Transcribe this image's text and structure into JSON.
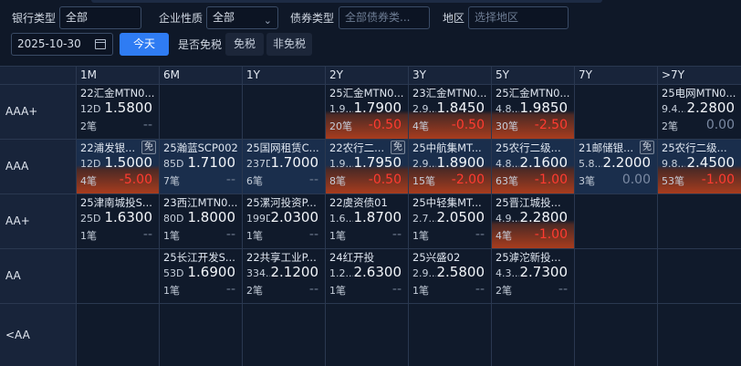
{
  "filters": {
    "bank_type_label": "银行类型",
    "bank_type_value": "全部",
    "company_type_label": "企业性质",
    "company_type_value": "全部",
    "bond_type_label": "债券类型",
    "bond_type_placeholder": "全部债券类...",
    "region_label": "地区",
    "region_placeholder": "选择地区",
    "date_value": "2025-10-30",
    "today_label": "今天",
    "tax_label": "是否免税",
    "tax_free_label": "免税",
    "non_tax_free_label": "非免税"
  },
  "columns": [
    "1M",
    "6M",
    "1Y",
    "2Y",
    "3Y",
    "5Y",
    "7Y",
    ">7Y"
  ],
  "rows": [
    "AAA+",
    "AAA",
    "AA+",
    "AA",
    "<AA"
  ],
  "cells": [
    {
      "row": 0,
      "col": 0,
      "name": "22汇金MTN0...",
      "term": "12D",
      "yield": "1.5800",
      "count": "2笔",
      "change": "--",
      "tone": "dash",
      "blue": false,
      "red": false,
      "badge": ""
    },
    {
      "row": 0,
      "col": 3,
      "name": "25汇金MTN0...",
      "term": "1.9...",
      "yield": "1.7900",
      "count": "20笔",
      "change": "-0.50",
      "tone": "neg",
      "blue": false,
      "red": true,
      "badge": ""
    },
    {
      "row": 0,
      "col": 4,
      "name": "23汇金MTN0...",
      "term": "2.9...",
      "yield": "1.8450",
      "count": "4笔",
      "change": "-0.50",
      "tone": "neg",
      "blue": false,
      "red": true,
      "badge": ""
    },
    {
      "row": 0,
      "col": 5,
      "name": "25汇金MTN0...",
      "term": "4.8...",
      "yield": "1.9850",
      "count": "30笔",
      "change": "-2.50",
      "tone": "neg",
      "blue": false,
      "red": true,
      "badge": ""
    },
    {
      "row": 0,
      "col": 7,
      "name": "25电网MTN0...",
      "term": "9.4...",
      "yield": "2.2800",
      "count": "2笔",
      "change": "0.00",
      "tone": "zero",
      "blue": false,
      "red": false,
      "badge": ""
    },
    {
      "row": 1,
      "col": 0,
      "name": "22浦发银...",
      "term": "12D",
      "yield": "1.5000",
      "count": "4笔",
      "change": "-5.00",
      "tone": "neg",
      "blue": true,
      "red": true,
      "badge": "免"
    },
    {
      "row": 1,
      "col": 1,
      "name": "25瀚蓝SCP002",
      "term": "85D",
      "yield": "1.7100",
      "count": "7笔",
      "change": "--",
      "tone": "dash",
      "blue": true,
      "red": false,
      "badge": ""
    },
    {
      "row": 1,
      "col": 2,
      "name": "25国网租赁C...",
      "term": "237D",
      "yield": "1.7000",
      "count": "6笔",
      "change": "--",
      "tone": "dash",
      "blue": true,
      "red": false,
      "badge": ""
    },
    {
      "row": 1,
      "col": 3,
      "name": "22农行二...",
      "term": "1.9...",
      "yield": "1.7950",
      "count": "8笔",
      "change": "-0.50",
      "tone": "neg",
      "blue": true,
      "red": true,
      "badge": "免"
    },
    {
      "row": 1,
      "col": 4,
      "name": "25中航集MT...",
      "term": "2.9...",
      "yield": "1.8900",
      "count": "15笔",
      "change": "-2.00",
      "tone": "neg",
      "blue": true,
      "red": true,
      "badge": ""
    },
    {
      "row": 1,
      "col": 5,
      "name": "25农行二级...",
      "term": "4.8...",
      "yield": "2.1600",
      "count": "63笔",
      "change": "-1.00",
      "tone": "neg",
      "blue": true,
      "red": true,
      "badge": ""
    },
    {
      "row": 1,
      "col": 6,
      "name": "21邮储银...",
      "term": "5.8...",
      "yield": "2.2000",
      "count": "3笔",
      "change": "0.00",
      "tone": "zero",
      "blue": true,
      "red": false,
      "badge": "免"
    },
    {
      "row": 1,
      "col": 7,
      "name": "25农行二级...",
      "term": "9.8...",
      "yield": "2.4500",
      "count": "53笔",
      "change": "-1.00",
      "tone": "neg",
      "blue": true,
      "red": true,
      "badge": ""
    },
    {
      "row": 2,
      "col": 0,
      "name": "25津南城投S...",
      "term": "25D",
      "yield": "1.6300",
      "count": "1笔",
      "change": "--",
      "tone": "dash",
      "blue": false,
      "red": false,
      "badge": ""
    },
    {
      "row": 2,
      "col": 1,
      "name": "23西江MTN0...",
      "term": "80D",
      "yield": "1.8000",
      "count": "1笔",
      "change": "--",
      "tone": "dash",
      "blue": false,
      "red": false,
      "badge": ""
    },
    {
      "row": 2,
      "col": 2,
      "name": "25漯河投资P...",
      "term": "199D",
      "yield": "2.0300",
      "count": "1笔",
      "change": "--",
      "tone": "dash",
      "blue": false,
      "red": false,
      "badge": ""
    },
    {
      "row": 2,
      "col": 3,
      "name": "22虞资债01",
      "term": "1.6...",
      "yield": "1.8700",
      "count": "1笔",
      "change": "--",
      "tone": "dash",
      "blue": false,
      "red": false,
      "badge": ""
    },
    {
      "row": 2,
      "col": 4,
      "name": "25中轻集MT...",
      "term": "2.7...",
      "yield": "2.0500",
      "count": "1笔",
      "change": "--",
      "tone": "dash",
      "blue": false,
      "red": false,
      "badge": ""
    },
    {
      "row": 2,
      "col": 5,
      "name": "25晋江城投...",
      "term": "4.9...",
      "yield": "2.2800",
      "count": "4笔",
      "change": "-1.00",
      "tone": "neg",
      "blue": false,
      "red": true,
      "badge": ""
    },
    {
      "row": 3,
      "col": 1,
      "name": "25长江开发S...",
      "term": "53D",
      "yield": "1.6900",
      "count": "1笔",
      "change": "--",
      "tone": "dash",
      "blue": false,
      "red": false,
      "badge": ""
    },
    {
      "row": 3,
      "col": 2,
      "name": "22共享工业P...",
      "term": "334...",
      "yield": "2.1200",
      "count": "2笔",
      "change": "--",
      "tone": "dash",
      "blue": false,
      "red": false,
      "badge": ""
    },
    {
      "row": 3,
      "col": 3,
      "name": "24红开投",
      "term": "1.2...",
      "yield": "2.6300",
      "count": "1笔",
      "change": "--",
      "tone": "dash",
      "blue": false,
      "red": false,
      "badge": ""
    },
    {
      "row": 3,
      "col": 4,
      "name": "25兴盛02",
      "term": "2.9...",
      "yield": "2.5800",
      "count": "1笔",
      "change": "--",
      "tone": "dash",
      "blue": false,
      "red": false,
      "badge": ""
    },
    {
      "row": 3,
      "col": 5,
      "name": "25滹沱新投...",
      "term": "4.3...",
      "yield": "2.7300",
      "count": "2笔",
      "change": "--",
      "tone": "dash",
      "blue": false,
      "red": false,
      "badge": ""
    }
  ]
}
